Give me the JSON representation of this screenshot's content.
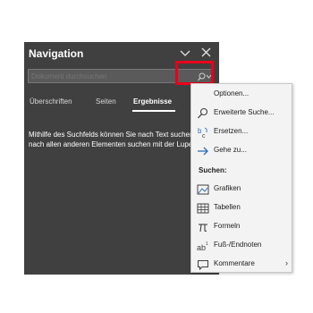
{
  "nav": {
    "title": "Navigation",
    "search_placeholder": "Dokument durchsuchen",
    "tabs": [
      {
        "label": "Überschriften",
        "active": false
      },
      {
        "label": "Seiten",
        "active": false
      },
      {
        "label": "Ergebnisse",
        "active": true
      }
    ],
    "hint": "Mithilfe des Suchfelds können Sie nach Text suchen, nach allen anderen Elementen suchen mit der Lupe."
  },
  "menu": {
    "items_top": [
      {
        "label": "Optionen...",
        "icon": "none"
      },
      {
        "label": "Erweiterte Suche...",
        "icon": "search-icon"
      },
      {
        "label": "Ersetzen...",
        "icon": "replace-icon"
      },
      {
        "label": "Gehe zu...",
        "icon": "arrow-right-icon"
      }
    ],
    "section_label": "Suchen:",
    "items_find": [
      {
        "label": "Grafiken",
        "icon": "image-icon"
      },
      {
        "label": "Tabellen",
        "icon": "table-icon"
      },
      {
        "label": "Formeln",
        "icon": "pi-icon"
      },
      {
        "label": "Fuß-/Endnoten",
        "icon": "footnote-icon"
      },
      {
        "label": "Kommentare",
        "icon": "comment-icon",
        "submenu": true
      }
    ]
  },
  "colors": {
    "pane_bg": "#404040",
    "menu_bg": "#f3f3f3",
    "highlight": "#e8001c",
    "icon_blue": "#2f6fb8"
  }
}
